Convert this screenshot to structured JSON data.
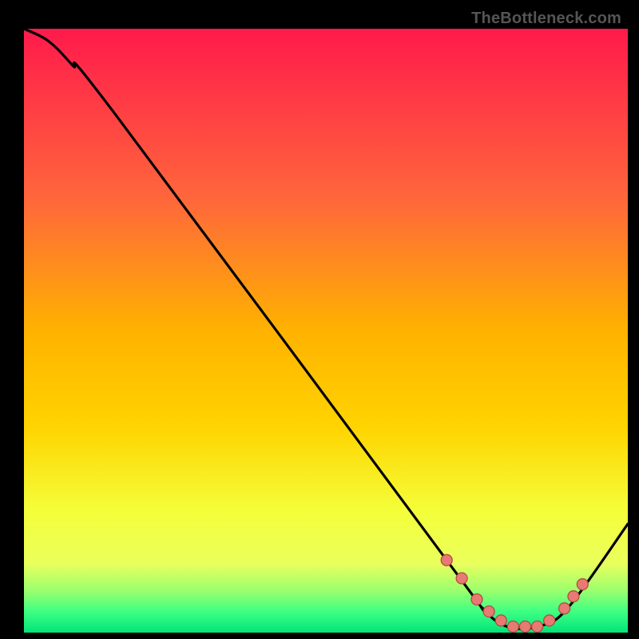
{
  "watermark": "TheBottleneck.com",
  "chart_data": {
    "type": "line",
    "title": "",
    "xlabel": "",
    "ylabel": "",
    "xlim": [
      0,
      100
    ],
    "ylim": [
      0,
      100
    ],
    "grid": false,
    "series": [
      {
        "name": "curve",
        "x": [
          0,
          4,
          8,
          15,
          70,
          76,
          80,
          85,
          90,
          100
        ],
        "y": [
          100,
          98,
          94,
          86,
          12,
          4,
          1,
          1,
          4,
          18
        ]
      }
    ],
    "markers": {
      "name": "points",
      "x": [
        70,
        72.5,
        75,
        77,
        79,
        81,
        83,
        85,
        87,
        89.5,
        91,
        92.5
      ],
      "y": [
        12,
        9,
        5.5,
        3.5,
        2,
        1,
        1,
        1,
        2,
        4,
        6,
        8
      ]
    },
    "background_gradient": {
      "top": "#ff1a4b",
      "mid": "#ffd400",
      "low1": "#eaff5c",
      "low2": "#9cff6e",
      "bottom": "#00e47a"
    },
    "colors": {
      "curve": "#000000",
      "marker_fill": "#e77a72",
      "marker_stroke": "#b5453e"
    }
  }
}
